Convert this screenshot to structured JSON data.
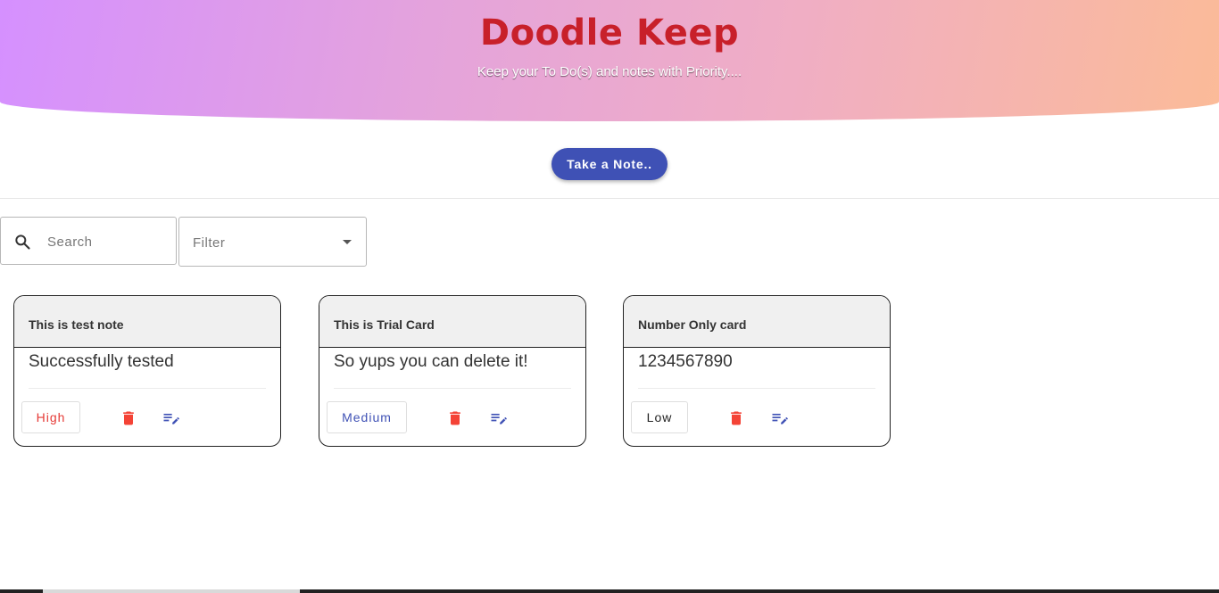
{
  "header": {
    "title": "Doodle Keep",
    "subtitle": "Keep your To Do(s) and notes with Priority...."
  },
  "actions": {
    "take_note_label": "Take a Note.."
  },
  "search": {
    "placeholder": "Search"
  },
  "filter": {
    "label": "Filter"
  },
  "colors": {
    "accent": "#3f51b5",
    "title_red": "#c8202a",
    "delete_red": "#f44336",
    "high": "#e53935",
    "medium": "#3f51b5",
    "low": "#222222"
  },
  "notes": [
    {
      "title": "This is test note",
      "body": "Successfully tested",
      "priority": "High",
      "delete_icon": "delete-icon",
      "edit_icon": "edit-note-icon"
    },
    {
      "title": "This is Trial Card",
      "body": "So yups you can delete it!",
      "priority": "Medium",
      "delete_icon": "delete-icon",
      "edit_icon": "edit-note-icon"
    },
    {
      "title": "Number Only card",
      "body": "1234567890",
      "priority": "Low",
      "delete_icon": "delete-icon",
      "edit_icon": "edit-note-icon"
    }
  ]
}
